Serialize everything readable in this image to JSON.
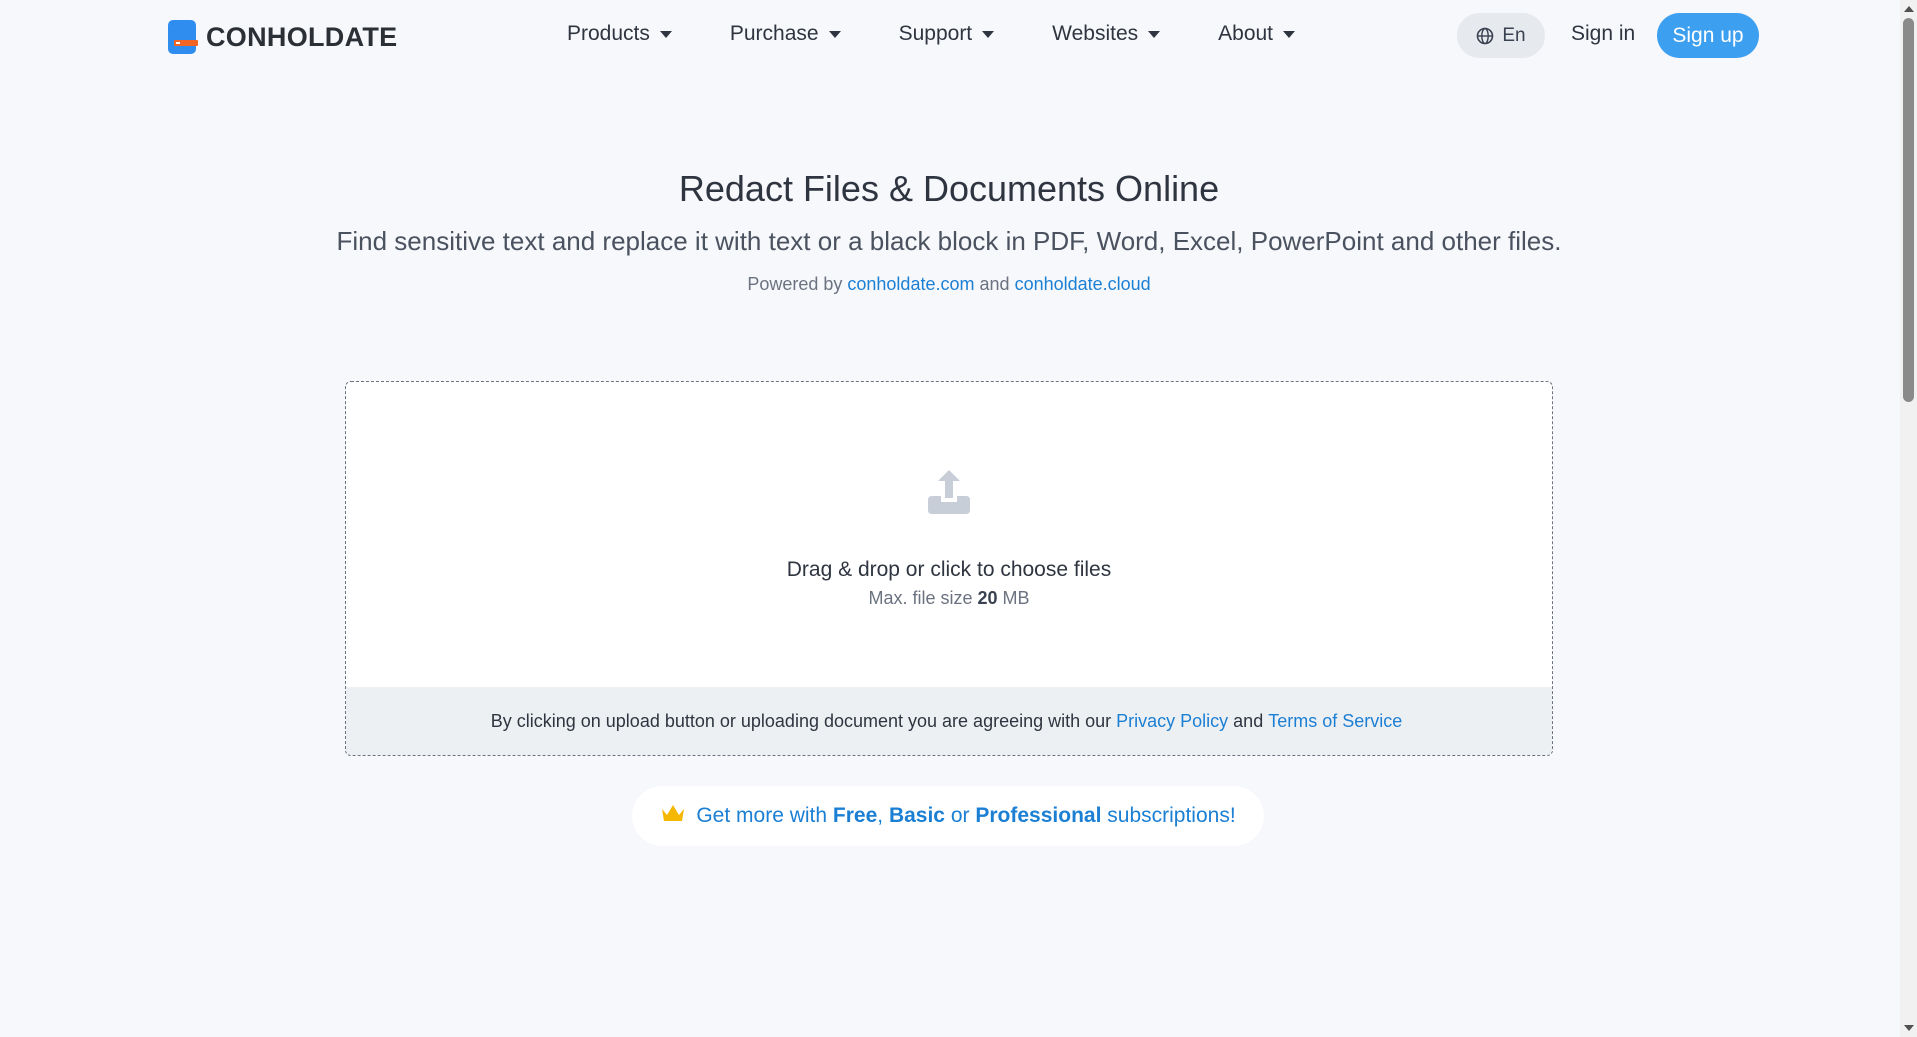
{
  "header": {
    "logo_text": "CONHOLDATE",
    "nav": [
      {
        "label": "Products"
      },
      {
        "label": "Purchase"
      },
      {
        "label": "Support"
      },
      {
        "label": "Websites"
      },
      {
        "label": "About"
      }
    ],
    "language": "En",
    "signin_label": "Sign in",
    "signup_label": "Sign up"
  },
  "hero": {
    "title": "Redact Files & Documents Online",
    "subtitle": "Find sensitive text and replace it with text or a black block in PDF, Word, Excel, PowerPoint and other files.",
    "powered_prefix": "Powered by",
    "powered_link1": "conholdate.com",
    "powered_and": "and",
    "powered_link2": "conholdate.cloud"
  },
  "upload": {
    "drop_text": "Drag & drop or click to choose files",
    "size_prefix": "Max. file size",
    "size_value": "20",
    "size_unit": "MB",
    "agree_text": "By clicking on upload button or uploading document you are agreeing with our",
    "privacy_label": "Privacy Policy",
    "agree_and": "and",
    "terms_label": "Terms of Service"
  },
  "promo": {
    "prefix": "Get more with",
    "free": "Free",
    "comma": ",",
    "basic": "Basic",
    "or": "or",
    "professional": "Professional",
    "suffix": "subscriptions!"
  },
  "colors": {
    "accent": "#3d9ff0",
    "link": "#1b7fd4",
    "background": "#f7f8fb",
    "crown": "#f5b800"
  },
  "icons": {
    "logo": "conholdate-logo-icon",
    "globe": "globe-icon",
    "upload": "upload-icon",
    "crown": "crown-icon"
  }
}
